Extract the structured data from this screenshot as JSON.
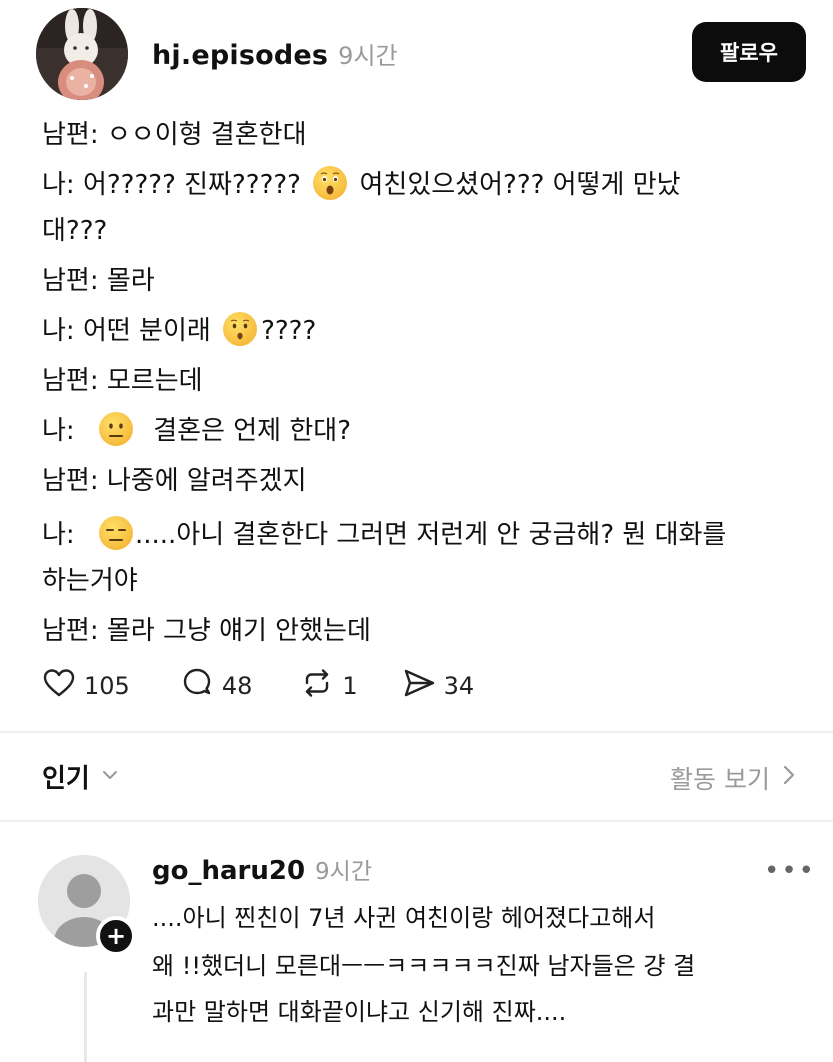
{
  "post": {
    "author": "hj.episodes",
    "time": "9시간",
    "follow_label": "팔로우",
    "lines": [
      {
        "before": "남편: ㅇㅇ이형 결혼한대",
        "emoji": "",
        "after": ""
      },
      {
        "before": "나: 어????? 진짜?????",
        "emoji": "astonished-face",
        "after": "여친있으셨어??? 어떻게 만났"
      },
      {
        "before": "대???",
        "emoji": "",
        "after": ""
      },
      {
        "before": "남편: 몰라",
        "emoji": "",
        "after": ""
      },
      {
        "before": "나: 어떤 분이래",
        "emoji": "hushed-face",
        "after": "????"
      },
      {
        "before": "남편: 모르는데",
        "emoji": "",
        "after": ""
      },
      {
        "before": "나:",
        "emoji": "neutral-face",
        "after": "결혼은 언제 한대?"
      },
      {
        "before": "남편: 나중에 알려주겠지",
        "emoji": "",
        "after": ""
      },
      {
        "before": "나:",
        "emoji": "expressionless-face",
        "after": ".....아니 결혼한다 그러면 저런게 안 궁금해? 뭔 대화를"
      },
      {
        "before": "하는거야",
        "emoji": "",
        "after": ""
      },
      {
        "before": "남편: 몰라 그냥 얘기 안했는데",
        "emoji": "",
        "after": ""
      }
    ]
  },
  "actions": {
    "likes": "105",
    "comments": "48",
    "reposts": "1",
    "shares": "34"
  },
  "sort": {
    "label": "인기",
    "activity_label": "활동 보기"
  },
  "comment": {
    "author": "go_haru20",
    "time": "9시간",
    "more": "•••",
    "plus": "+",
    "lines": [
      "....아니 찐친이 7년 사귄 여친이랑 헤어졌다고해서",
      "왜 !!했더니 모른대ㅡㅡㅋㅋㅋㅋㅋ진짜 남자들은 걍 결",
      "과만 말하면 대화끝이냐고 신기해 진짜...."
    ]
  },
  "colors": {
    "follow_bg": "#0c0c0c",
    "muted_text": "#9a9a9a",
    "emoji_yellow": "#f6b93b"
  }
}
